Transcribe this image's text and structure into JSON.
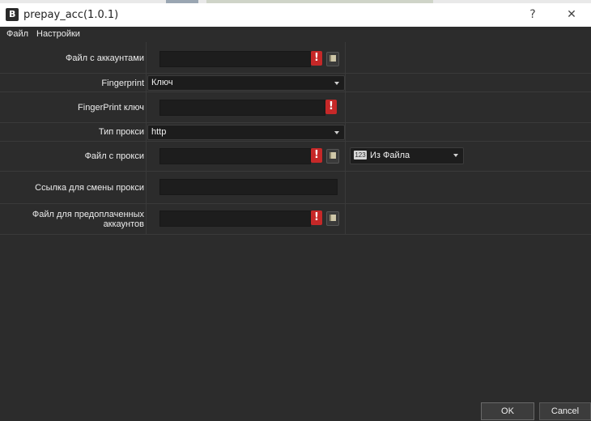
{
  "window": {
    "icon_letter": "B",
    "title": "prepay_acc(1.0.1)",
    "help_glyph": "?",
    "close_glyph": "✕"
  },
  "menu": {
    "items": [
      "Файл",
      "Настройки"
    ]
  },
  "form": {
    "accounts_file": {
      "label": "Файл с аккаунтами",
      "value": ""
    },
    "fingerprint": {
      "label": "Fingerprint",
      "selected": "Ключ"
    },
    "fingerprint_key": {
      "label": "FingerPrint ключ",
      "value": ""
    },
    "proxy_type": {
      "label": "Тип прокси",
      "selected": "http"
    },
    "proxy_file": {
      "label": "Файл с прокси",
      "value": "",
      "source_badge": "123",
      "source_selected": "Из Файла"
    },
    "proxy_change_url": {
      "label": "Ссылка для смены прокси",
      "value": ""
    },
    "prepaid_file": {
      "label_line1": "Файл для предоплаченных",
      "label_line2": "аккаунтов",
      "value": ""
    }
  },
  "warning_glyph": "!",
  "buttons": {
    "ok": "OK",
    "cancel": "Cancel"
  },
  "colors": {
    "warning": "#c62828",
    "background": "#2c2c2c",
    "field": "#1d1d1d"
  }
}
